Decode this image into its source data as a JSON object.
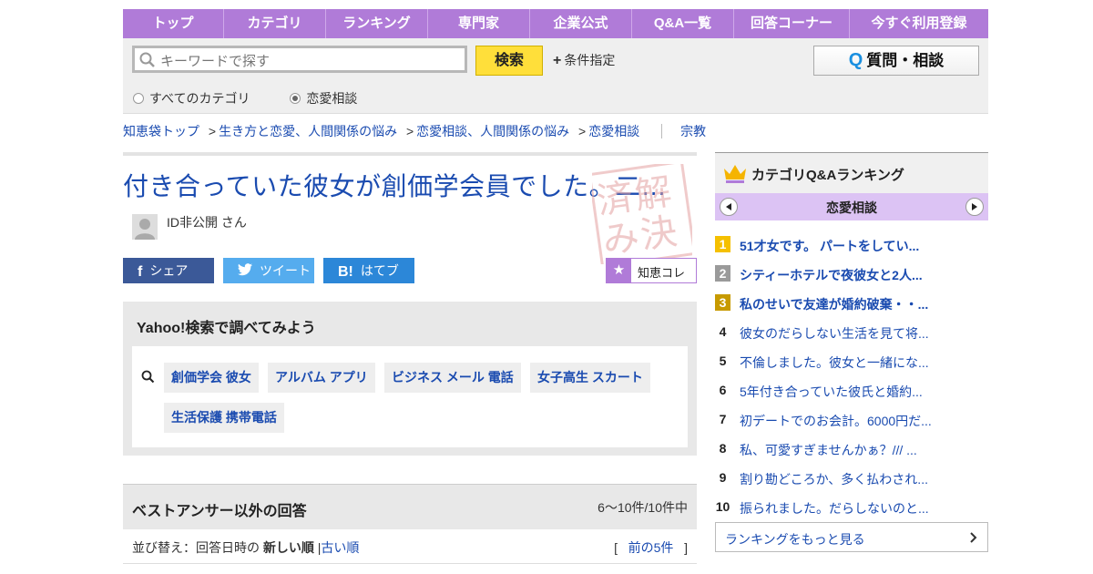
{
  "nav": [
    "トップ",
    "カテゴリ",
    "ランキング",
    "専門家",
    "企業公式",
    "Q&A一覧",
    "回答コーナー",
    "今すぐ利用登録"
  ],
  "search": {
    "placeholder": "キーワードで探す",
    "button": "検索",
    "conditions": "条件指定",
    "ask_button": "質問・相談",
    "radio_all": "すべてのカテゴリ",
    "radio_cat": "恋愛相談"
  },
  "breadcrumb": {
    "items": [
      "知恵袋トップ",
      "生き方と恋愛、人間関係の悩み",
      "恋愛相談、人間関係の悩み",
      "恋愛相談"
    ],
    "separator": ">",
    "tag": "宗教"
  },
  "question": {
    "title": "付き合っていた彼女が創価学会員でした。二…",
    "user": "ID非公開 さん",
    "stamp": [
      "解",
      "決",
      "済",
      "み"
    ]
  },
  "share": {
    "facebook": "シェア",
    "twitter": "ツイート",
    "hatena": "はてブ",
    "hatena_icon": "B!",
    "chiekore": "知恵コレ"
  },
  "yahoo_search": {
    "title": "Yahoo!検索で調べてみよう",
    "keywords": [
      "創価学会 彼女",
      "アルバム アプリ",
      "ビジネス メール 電話",
      "女子高生 スカート",
      "生活保護 携帯電話"
    ]
  },
  "answers": {
    "title": "ベストアンサー以外の回答",
    "count": "6〜10件/10件中",
    "sort_label": "並び替え：回答日時の",
    "sort_new": "新しい順",
    "sort_divider": "|",
    "sort_old": "古い順",
    "bracket_open": "[",
    "prev": "前の5件",
    "bracket_close": "]"
  },
  "sidebar": {
    "title": "カテゴリQ&Aランキング",
    "category": "恋愛相談",
    "ranking": [
      {
        "rank": "1",
        "text": "51才女です。 パートをしてい..."
      },
      {
        "rank": "2",
        "text": "シティーホテルで夜彼女と2人..."
      },
      {
        "rank": "3",
        "text": "私のせいで友達が婚約破棄・・..."
      },
      {
        "rank": "4",
        "text": "彼女のだらしない生活を見て将..."
      },
      {
        "rank": "5",
        "text": "不倫しました。彼女と一緒にな..."
      },
      {
        "rank": "6",
        "text": "5年付き合っていた彼氏と婚約..."
      },
      {
        "rank": "7",
        "text": "初デートでのお会計。6000円だ..."
      },
      {
        "rank": "8",
        "text": "私、可愛すぎませんかぁ？/// ..."
      },
      {
        "rank": "9",
        "text": "割り勘どころか、多く払わされ..."
      },
      {
        "rank": "10",
        "text": "振られました。だらしないのと..."
      }
    ],
    "rank_colors": [
      "#f5c000",
      "#9a9a9a",
      "#c79a00"
    ],
    "more": "ランキングをもっと見る"
  },
  "colors": {
    "nav_bg": "#b07bd8",
    "link": "#1a4bb0",
    "search_button": "#ffdf3a",
    "facebook": "#3b5998",
    "twitter": "#55acee",
    "hatena": "#2c87d8",
    "stamp": "#e3a0a0"
  }
}
